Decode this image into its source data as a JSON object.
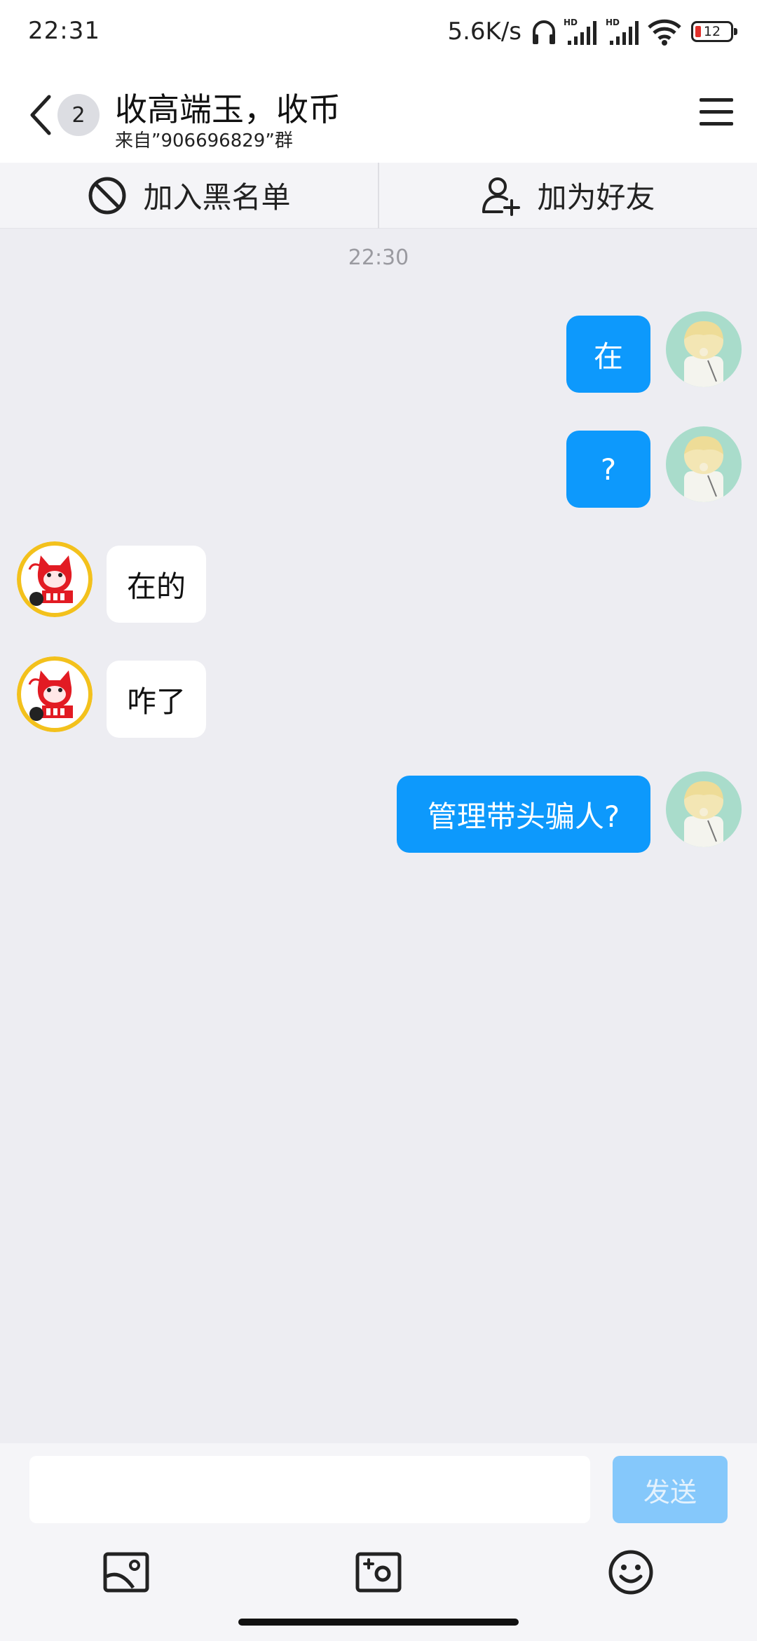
{
  "status_bar": {
    "time": "22:31",
    "net_speed": "5.6K/s",
    "battery": "12",
    "icons": [
      "headphones-icon",
      "signal-hd-icon",
      "signal-hd-icon",
      "wifi-icon",
      "battery-icon"
    ],
    "hd_label": "HD"
  },
  "header": {
    "unread_count": "2",
    "title": "收高端玉，收币",
    "subtitle": "来自”906696829”群"
  },
  "action_bar": {
    "block_label": "加入黑名单",
    "add_friend_label": "加为好友"
  },
  "chat": {
    "timestamp": "22:30",
    "messages": [
      {
        "side": "out",
        "text": "在"
      },
      {
        "side": "out",
        "text": "?"
      },
      {
        "side": "in",
        "text": "在的"
      },
      {
        "side": "in",
        "text": "咋了"
      },
      {
        "side": "out",
        "text": "管理带头骗人?"
      }
    ]
  },
  "composer": {
    "placeholder": "",
    "send_label": "发送",
    "tools": [
      "image-icon",
      "camera-icon",
      "emoji-icon"
    ]
  },
  "colors": {
    "outgoing_bubble": "#0d99fc",
    "incoming_bubble": "#ffffff",
    "chat_background": "#ededf2",
    "send_disabled": "#85c8fb"
  }
}
